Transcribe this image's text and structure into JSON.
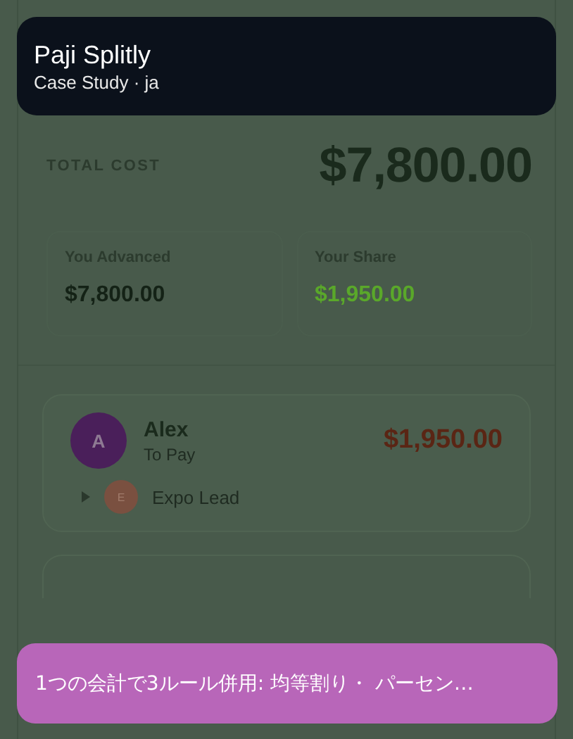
{
  "header": {
    "title": "Paji Splitly",
    "subtitle": "Case Study · ja"
  },
  "total": {
    "label": "TOTAL COST",
    "amount": "$7,800.00"
  },
  "stats": [
    {
      "label": "You Advanced",
      "value": "$7,800.00",
      "color": "#142216"
    },
    {
      "label": "Your Share",
      "value": "$1,950.00",
      "color": "#5aa82a"
    }
  ],
  "members": [
    {
      "initial": "A",
      "name": "Alex",
      "role": "To Pay",
      "amount": "$1,950.00",
      "color": "#4a1f5a",
      "expanded": false,
      "children": [
        {
          "initial": "E",
          "name": "Expo Lead",
          "color": "#7a5040"
        }
      ]
    }
  ],
  "caption": "1つの会計で3ルール併用: 均等割り・ パーセン…"
}
